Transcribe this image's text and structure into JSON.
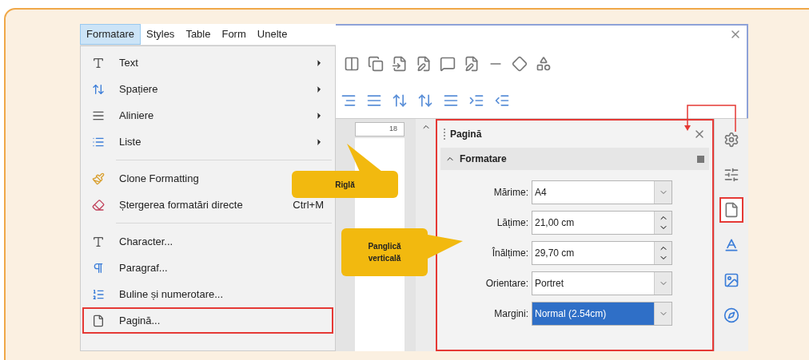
{
  "menu_bar": [
    {
      "label": "Formatare",
      "selected": true
    },
    {
      "label": "Styles",
      "selected": false
    },
    {
      "label": "Table",
      "selected": false
    },
    {
      "label": "Form",
      "selected": false
    },
    {
      "label": "Unelte",
      "selected": false
    }
  ],
  "menu": {
    "groups": [
      [
        {
          "label": "Text",
          "submenu": true,
          "highlighted": false
        },
        {
          "label": "Spațiere",
          "submenu": true,
          "highlighted": false
        },
        {
          "label": "Aliniere",
          "submenu": true,
          "highlighted": false
        },
        {
          "label": "Liste",
          "submenu": true,
          "highlighted": false
        }
      ],
      [
        {
          "label": "Clone Formatting",
          "highlighted": false
        },
        {
          "label": "Ștergerea formatări directe",
          "shortcut": "Ctrl+M",
          "highlighted": false
        }
      ],
      [
        {
          "label": "Character...",
          "highlighted": false
        },
        {
          "label": "Paragraf...",
          "highlighted": false
        },
        {
          "label": "Buline și numerotare...",
          "highlighted": false
        },
        {
          "label": "Pagină...",
          "highlighted": true
        }
      ]
    ]
  },
  "ruler": {
    "mark": "18"
  },
  "callouts": [
    {
      "text": "Riglă"
    },
    {
      "text": "Panglică verticală"
    }
  ],
  "sidebar_panel": {
    "title": "Pagină",
    "section": {
      "title": "Formatare",
      "expanded": true
    },
    "fields": [
      {
        "label": "Mărime:",
        "value": "A4",
        "kind": "dropdown",
        "selected": false
      },
      {
        "label": "Lățime:",
        "value": "21,00 cm",
        "kind": "spin",
        "selected": false
      },
      {
        "label": "Înălțime:",
        "value": "29,70 cm",
        "kind": "spin",
        "selected": false
      },
      {
        "label": "Orientare:",
        "value": "Portret",
        "kind": "dropdown",
        "selected": false
      },
      {
        "label": "Margini:",
        "value": "Normal (2.54cm)",
        "kind": "dropdown",
        "selected": true
      }
    ]
  },
  "sidebar_tabs": [
    {
      "kind": "properties",
      "selected": false
    },
    {
      "kind": "styles",
      "selected": false
    },
    {
      "kind": "page",
      "selected": true
    },
    {
      "kind": "fontwork",
      "selected": false
    },
    {
      "kind": "gallery",
      "selected": false
    },
    {
      "kind": "navigator",
      "selected": false
    }
  ]
}
